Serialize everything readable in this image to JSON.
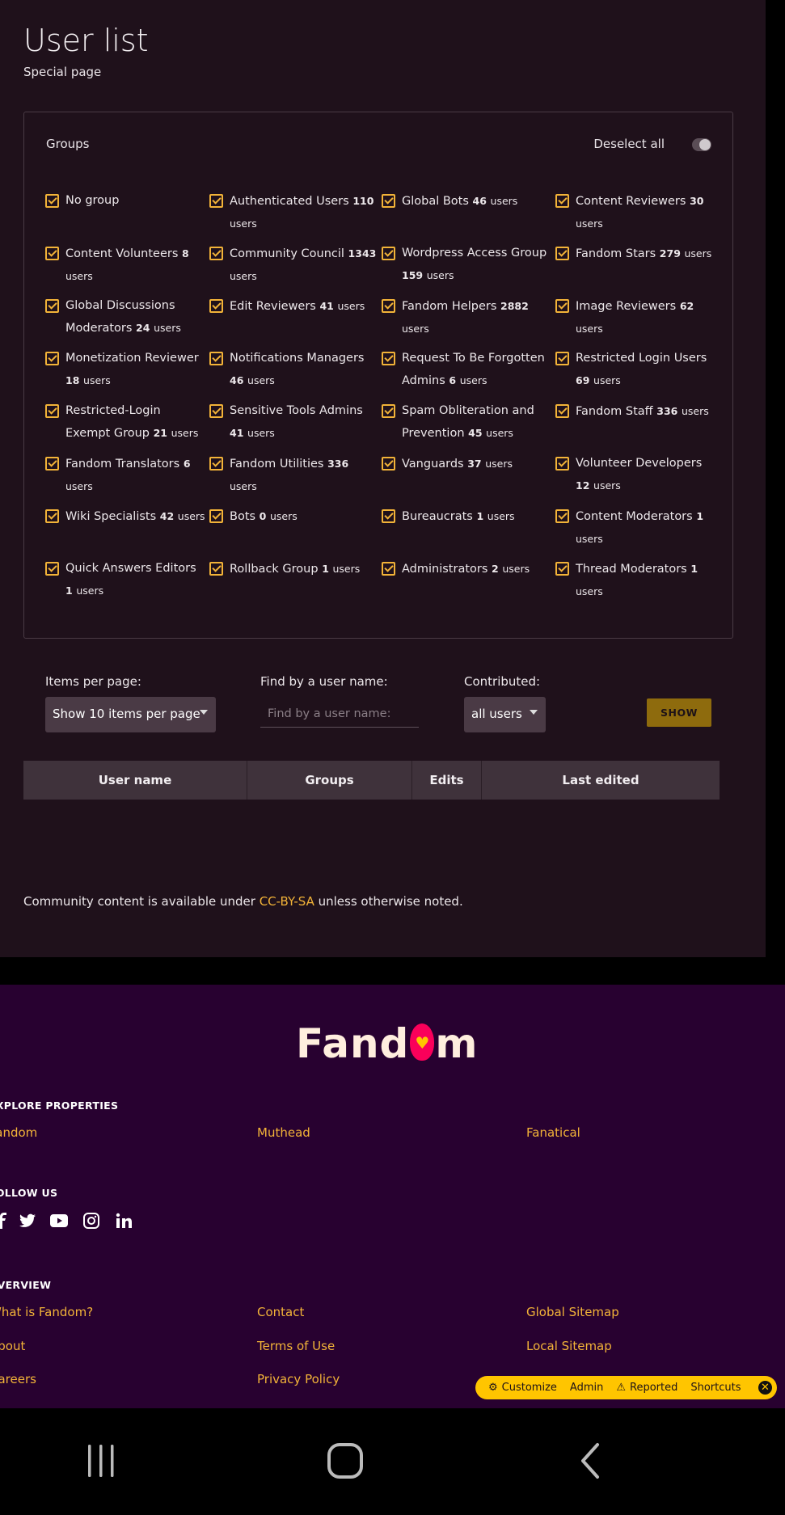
{
  "page": {
    "title": "User list",
    "subtitle": "Special page"
  },
  "groups": {
    "label": "Groups",
    "deselect_label": "Deselect all",
    "items": [
      {
        "name": "No group",
        "count": "",
        "units": ""
      },
      {
        "name": "Authenticated Users",
        "count": "110",
        "units": "users"
      },
      {
        "name": "Global Bots",
        "count": "46",
        "units": "users"
      },
      {
        "name": "Content Reviewers",
        "count": "30",
        "units": "users"
      },
      {
        "name": "Content Volunteers",
        "count": "8",
        "units": "users"
      },
      {
        "name": "Community Council",
        "count": "1343",
        "units": "users"
      },
      {
        "name": "Wordpress Access Group",
        "count": "159",
        "units": "users"
      },
      {
        "name": "Fandom Stars",
        "count": "279",
        "units": "users"
      },
      {
        "name": "Global Discussions Moderators",
        "count": "24",
        "units": "users"
      },
      {
        "name": "Edit Reviewers",
        "count": "41",
        "units": "users"
      },
      {
        "name": "Fandom Helpers",
        "count": "2882",
        "units": "users"
      },
      {
        "name": "Image Reviewers",
        "count": "62",
        "units": "users"
      },
      {
        "name": "Monetization Reviewer",
        "count": "18",
        "units": "users"
      },
      {
        "name": "Notifications Managers",
        "count": "46",
        "units": "users"
      },
      {
        "name": "Request To Be Forgotten Admins",
        "count": "6",
        "units": "users"
      },
      {
        "name": "Restricted Login Users",
        "count": "69",
        "units": "users"
      },
      {
        "name": "Restricted-Login Exempt Group",
        "count": "21",
        "units": "users"
      },
      {
        "name": "Sensitive Tools Admins",
        "count": "41",
        "units": "users"
      },
      {
        "name": "Spam Obliteration and Prevention",
        "count": "45",
        "units": "users"
      },
      {
        "name": "Fandom Staff",
        "count": "336",
        "units": "users"
      },
      {
        "name": "Fandom Translators",
        "count": "6",
        "units": "users"
      },
      {
        "name": "Fandom Utilities",
        "count": "336",
        "units": "users"
      },
      {
        "name": "Vanguards",
        "count": "37",
        "units": "users"
      },
      {
        "name": "Volunteer Developers",
        "count": "12",
        "units": "users"
      },
      {
        "name": "Wiki Specialists",
        "count": "42",
        "units": "users"
      },
      {
        "name": "Bots",
        "count": "0",
        "units": "users"
      },
      {
        "name": "Bureaucrats",
        "count": "1",
        "units": "users"
      },
      {
        "name": "Content Moderators",
        "count": "1",
        "units": "users"
      },
      {
        "name": "Quick Answers Editors",
        "count": "1",
        "units": "users"
      },
      {
        "name": "Rollback Group",
        "count": "1",
        "units": "users"
      },
      {
        "name": "Administrators",
        "count": "2",
        "units": "users"
      },
      {
        "name": "Thread Moderators",
        "count": "1",
        "units": "users"
      }
    ]
  },
  "filters": {
    "items_per_page_label": "Items per page:",
    "items_per_page_value": "Show 10 items per page",
    "find_label": "Find by a user name:",
    "find_placeholder": "Find by a user name:",
    "contributed_label": "Contributed:",
    "contributed_value": "all users",
    "show_button": "SHOW"
  },
  "table": {
    "headers": [
      "User name",
      "Groups",
      "Edits",
      "Last edited"
    ]
  },
  "license": {
    "prefix": "Community content is available under ",
    "link": "CC-BY-SA",
    "suffix": " unless otherwise noted."
  },
  "footer": {
    "logo": {
      "before": "Fand",
      "after": "m"
    },
    "explore_heading": "EXPLORE PROPERTIES",
    "explore_links": [
      "Fandom",
      "Muthead",
      "Fanatical"
    ],
    "follow_heading": "FOLLOW US",
    "overview_heading": "OVERVIEW",
    "overview_links": [
      "What is Fandom?",
      "Contact",
      "Global Sitemap",
      "About",
      "Terms of Use",
      "Local Sitemap",
      "Careers",
      "Privacy Policy"
    ]
  },
  "toolbar": {
    "customize": "Customize",
    "admin": "Admin",
    "reported": "Reported",
    "shortcuts": "Shortcuts"
  },
  "colors": {
    "accent": "#f2b338",
    "background": "#1f111b",
    "footer_bg": "#280130",
    "toolbar_bg": "#ffc500"
  }
}
